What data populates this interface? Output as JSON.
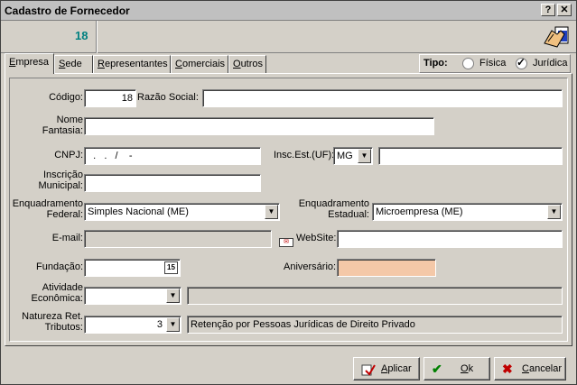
{
  "window": {
    "title": "Cadastro de Fornecedor",
    "help_label": "?",
    "close_label": "✕"
  },
  "header": {
    "record_code": "18"
  },
  "tabs": [
    {
      "label": "Empresa",
      "underline": "E",
      "rest": "mpresa"
    },
    {
      "label": "Sede",
      "underline": "S",
      "rest": "ede"
    },
    {
      "label": "Representantes",
      "underline": "R",
      "rest": "epresentantes"
    },
    {
      "label": "Comerciais",
      "underline": "C",
      "rest": "omerciais"
    },
    {
      "label": "Outros",
      "underline": "O",
      "rest": "utros"
    }
  ],
  "tipo": {
    "label": "Tipo:",
    "options": [
      "Física",
      "Jurídica"
    ],
    "selected": "Jurídica"
  },
  "form": {
    "codigo": {
      "label": "Código:",
      "value": "18"
    },
    "razao_social": {
      "label": "Razão Social:",
      "value": ""
    },
    "nome_fantasia": {
      "label_line1": "Nome",
      "label_line2": "Fantasia:",
      "value": ""
    },
    "cnpj": {
      "label": "CNPJ:",
      "value": "  .   .   /    -"
    },
    "insc_est": {
      "label": "Insc.Est.(UF):",
      "uf": "MG",
      "value": ""
    },
    "inscricao_municipal": {
      "label_line1": "Inscrição",
      "label_line2": "Municipal:",
      "value": ""
    },
    "enq_federal": {
      "label_line1": "Enquadramento",
      "label_line2": "Federal:",
      "value": "Simples Nacional (ME)"
    },
    "enq_estadual": {
      "label_line1": "Enquadramento",
      "label_line2": "Estadual:",
      "value": "Microempresa (ME)"
    },
    "email": {
      "label": "E-mail:",
      "value": ""
    },
    "website": {
      "label": "WebSite:",
      "value": ""
    },
    "fundacao": {
      "label": "Fundação:",
      "value": "",
      "calendar_icon": "15"
    },
    "aniversario": {
      "label": "Aniversário:",
      "value": ""
    },
    "atividade": {
      "label_line1": "Atividade",
      "label_line2": "Econômica:",
      "value": "",
      "description": ""
    },
    "natureza": {
      "label_line1": "Natureza Ret.",
      "label_line2": "Tributos:",
      "value": "3",
      "description": "Retenção por Pessoas Jurídicas de Direito Privado"
    }
  },
  "buttons": {
    "aplicar": {
      "label": "Aplicar",
      "underline": "A",
      "rest": "plicar"
    },
    "ok": {
      "label": "Ok",
      "underline": "O",
      "rest": "k"
    },
    "cancelar": {
      "label": "Cancelar",
      "underline": "C",
      "rest": "ancelar"
    }
  },
  "colors": {
    "code_teal": "#008080",
    "aniversario_bg": "#f4c8a8",
    "ok_green": "#008000",
    "cancel_red": "#c00000"
  }
}
